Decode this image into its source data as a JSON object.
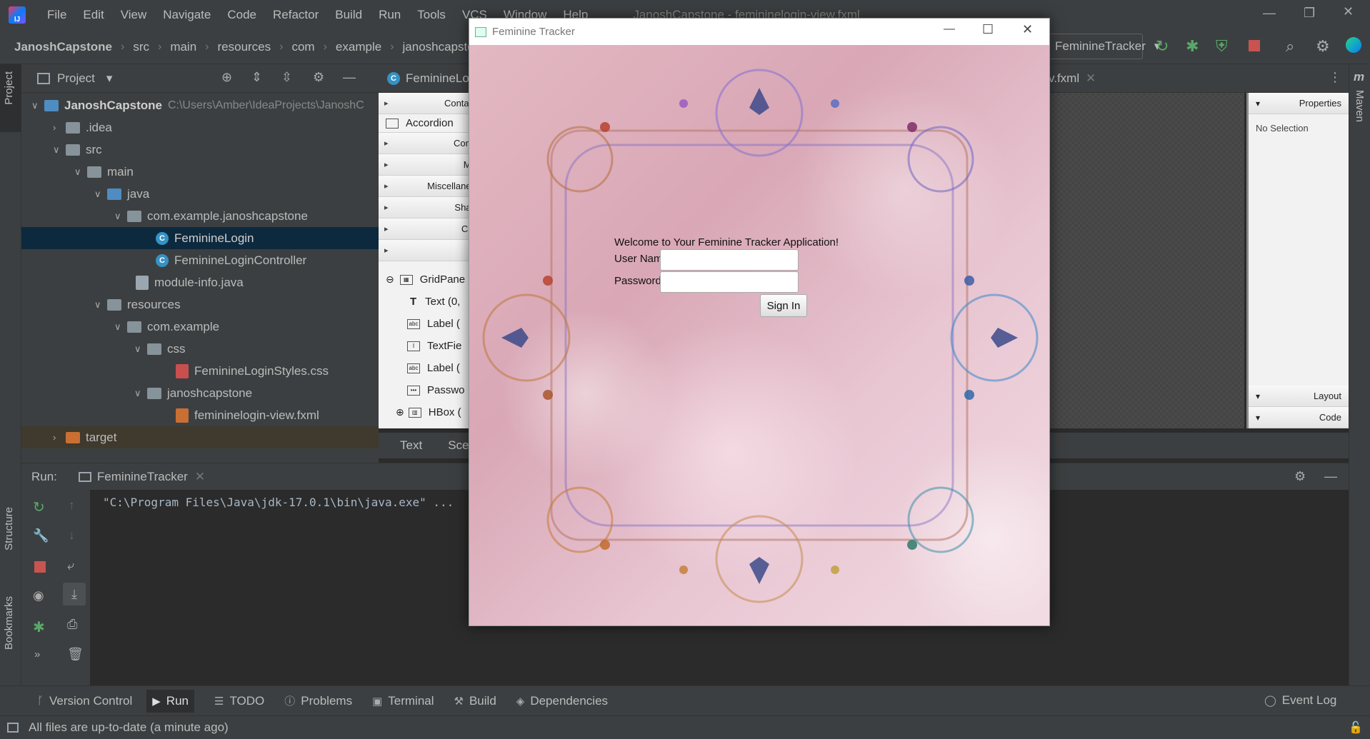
{
  "menubar": {
    "items": [
      "File",
      "Edit",
      "View",
      "Navigate",
      "Code",
      "Refactor",
      "Build",
      "Run",
      "Tools",
      "VCS",
      "Window",
      "Help"
    ],
    "title": "JanoshCapstone - femininelogin-view.fxml"
  },
  "breadcrumb": [
    "JanoshCapstone",
    "src",
    "main",
    "resources",
    "com",
    "example",
    "janoshcapstone"
  ],
  "run_config": "FeminineTracker",
  "project_panel": {
    "title": "Project",
    "tree": [
      {
        "label": "JanoshCapstone",
        "extra": "C:\\Users\\Amber\\IdeaProjects\\JanoshC",
        "level": 0
      },
      {
        "label": ".idea",
        "level": 1
      },
      {
        "label": "src",
        "level": 1
      },
      {
        "label": "main",
        "level": 2
      },
      {
        "label": "java",
        "level": 3
      },
      {
        "label": "com.example.janoshcapstone",
        "level": 4
      },
      {
        "label": "FeminineLogin",
        "level": 5
      },
      {
        "label": "FeminineLoginController",
        "level": 5
      },
      {
        "label": "module-info.java",
        "level": 4
      },
      {
        "label": "resources",
        "level": 3
      },
      {
        "label": "com.example",
        "level": 4
      },
      {
        "label": "css",
        "level": 5
      },
      {
        "label": "FeminineLoginStyles.css",
        "level": 6
      },
      {
        "label": "janoshcapstone",
        "level": 5
      },
      {
        "label": "femininelogin-view.fxml",
        "level": 6
      },
      {
        "label": "target",
        "level": 1
      }
    ]
  },
  "editor": {
    "tab_left": "FeminineLo",
    "tab_right": "v.fxml",
    "palette_sections": [
      "Containe",
      "Contro",
      "Men",
      "Miscellaneou",
      "Shape",
      "Char",
      "3"
    ],
    "palette_item": "Accordion",
    "hierarchy": [
      "GridPane",
      "Text (0,",
      "Label (",
      "TextFie",
      "Label (",
      "Passwo",
      "HBox ("
    ],
    "bottom_tabs": [
      "Text",
      "Sce"
    ],
    "properties_title": "Properties",
    "no_selection": "No Selection",
    "layout_label": "Layout",
    "code_label": "Code"
  },
  "side_tabs": {
    "project": "Project",
    "structure": "Structure",
    "bookmarks": "Bookmarks",
    "maven": "Maven"
  },
  "run_panel": {
    "label": "Run:",
    "tab": "FeminineTracker",
    "console_line": "\"C:\\Program Files\\Java\\jdk-17.0.1\\bin\\java.exe\" ..."
  },
  "bottom_tools": [
    "Version Control",
    "Run",
    "TODO",
    "Problems",
    "Terminal",
    "Build",
    "Dependencies"
  ],
  "event_log": "Event Log",
  "status": "All files are up-to-date (a minute ago)",
  "app_window": {
    "title": "Feminine Tracker",
    "welcome": "Welcome to Your Feminine Tracker Application!",
    "username_label": "User Name:",
    "password_label": "Password:",
    "username_value": "",
    "password_value": "",
    "signin_label": "Sign In"
  }
}
